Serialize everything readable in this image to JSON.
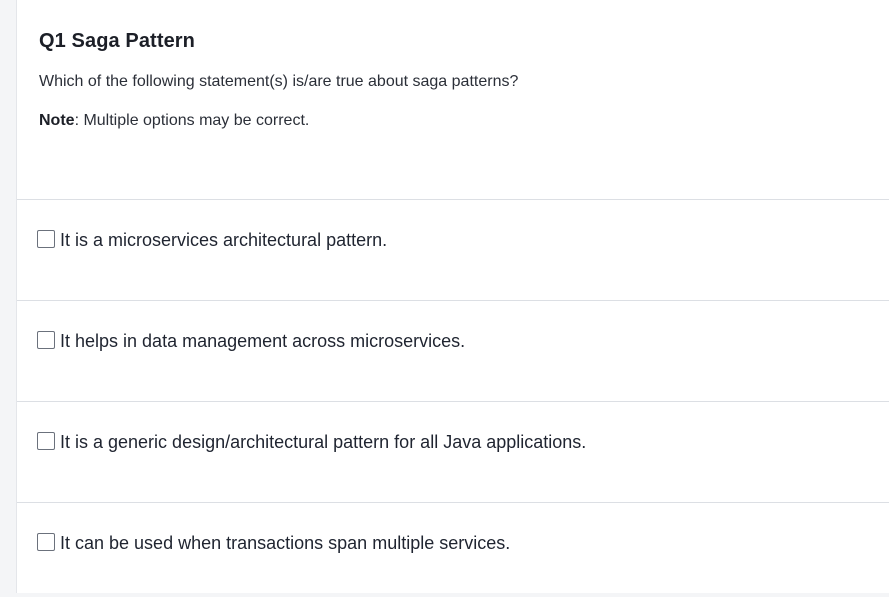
{
  "question": {
    "title": "Q1 Saga Pattern",
    "text": "Which of the following statement(s) is/are true about saga patterns?",
    "note_label": "Note",
    "note_text": ": Multiple options may be correct."
  },
  "options": [
    {
      "label": "It is a microservices architectural pattern.",
      "checked": false
    },
    {
      "label": "It helps in data management across microservices.",
      "checked": false
    },
    {
      "label": "It is a generic design/architectural pattern for all Java applications.",
      "checked": false
    },
    {
      "label": "It can be used when transactions span multiple services.",
      "checked": false
    }
  ]
}
